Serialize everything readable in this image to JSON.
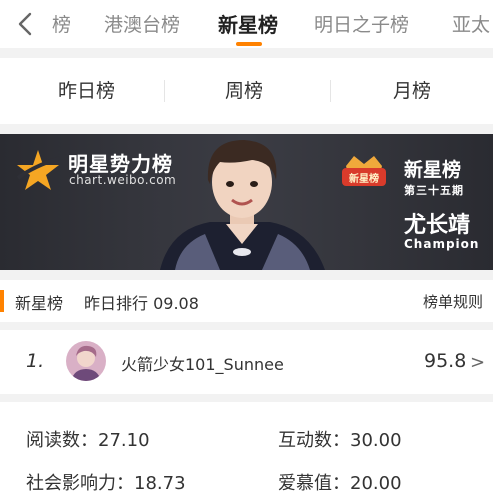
{
  "nav": {
    "tabs": [
      "榜",
      "港澳台榜",
      "新星榜",
      "明日之子榜",
      "亚太"
    ],
    "active_tab": "新星榜",
    "accent_color": "#ff8200"
  },
  "subnav": {
    "tabs": [
      "昨日榜",
      "周榜",
      "月榜"
    ]
  },
  "banner": {
    "logo_title": "明星势力榜",
    "logo_url": "chart.weibo.com",
    "badge_text": "新星榜",
    "rank_title": "新星榜",
    "rank_issue": "第三十五期",
    "winner_name": "尤长靖",
    "winner_label": "Champion"
  },
  "section": {
    "title": "新星榜",
    "date_text": "昨日排行 09.08",
    "rules_link": "榜单规则"
  },
  "entry": {
    "rank": "1.",
    "name": "火箭少女101_Sunnee",
    "score": "95.8",
    "arrow": ">"
  },
  "stats": {
    "reading": "阅读数：27.10",
    "interaction": "互动数：30.00",
    "influence": "社会影响力：18.73",
    "love": "爱慕值：20.00"
  }
}
